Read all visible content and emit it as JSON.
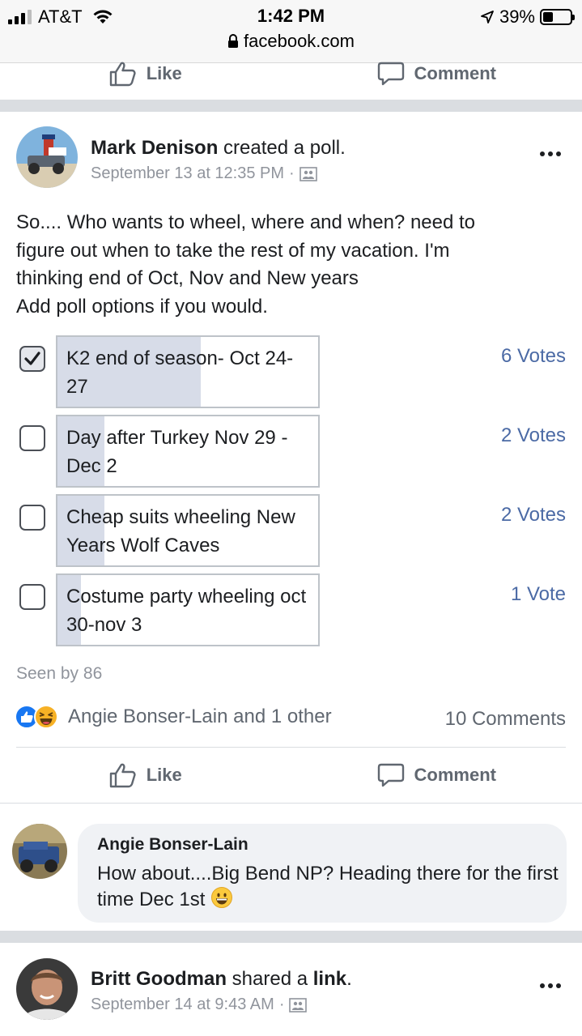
{
  "status_bar": {
    "carrier": "AT&T",
    "time": "1:42 PM",
    "url": "facebook.com",
    "battery": "39%",
    "battery_level": 0.39
  },
  "top_actions": {
    "like": "Like",
    "comment": "Comment"
  },
  "post": {
    "author": "Mark Denison",
    "action": " created a poll.",
    "timestamp": "September 13 at 12:35 PM",
    "separator": "·",
    "text_lines": [
      "So.... Who wants to wheel, where and when? need to",
      "figure out when to take the rest of my vacation. I'm",
      "thinking end of Oct, Nov and New years",
      "Add poll options if you would."
    ],
    "poll": [
      {
        "label": "K2 end of season- Oct 24-27",
        "votes": "6 Votes",
        "checked": true,
        "share": 0.55
      },
      {
        "label": "Day after Turkey Nov 29 - Dec 2",
        "votes": "2 Votes",
        "checked": false,
        "share": 0.18
      },
      {
        "label": "Cheap suits wheeling New Years Wolf Caves",
        "votes": "2 Votes",
        "checked": false,
        "share": 0.18
      },
      {
        "label": "Costume party wheeling oct 30-nov 3",
        "votes": "1 Vote",
        "checked": false,
        "share": 0.09
      }
    ],
    "seen_by": "Seen by 86",
    "reactors": "Angie Bonser-Lain and 1 other",
    "comments_count": "10 Comments",
    "like": "Like",
    "comment": "Comment"
  },
  "comment": {
    "author": "Angie Bonser-Lain",
    "text": "How about....Big Bend NP? Heading there for the first time Dec 1st"
  },
  "next_post": {
    "author": "Britt Goodman",
    "action_prefix": " shared a ",
    "action_link": "link",
    "action_suffix": ".",
    "timestamp": "September 14 at 9:43 AM",
    "separator": "·"
  },
  "colors": {
    "accent": "#4b6aa5",
    "poll_fill": "#d7dce8",
    "like_blue": "#1877f2",
    "haha_yellow": "#f7b125"
  }
}
